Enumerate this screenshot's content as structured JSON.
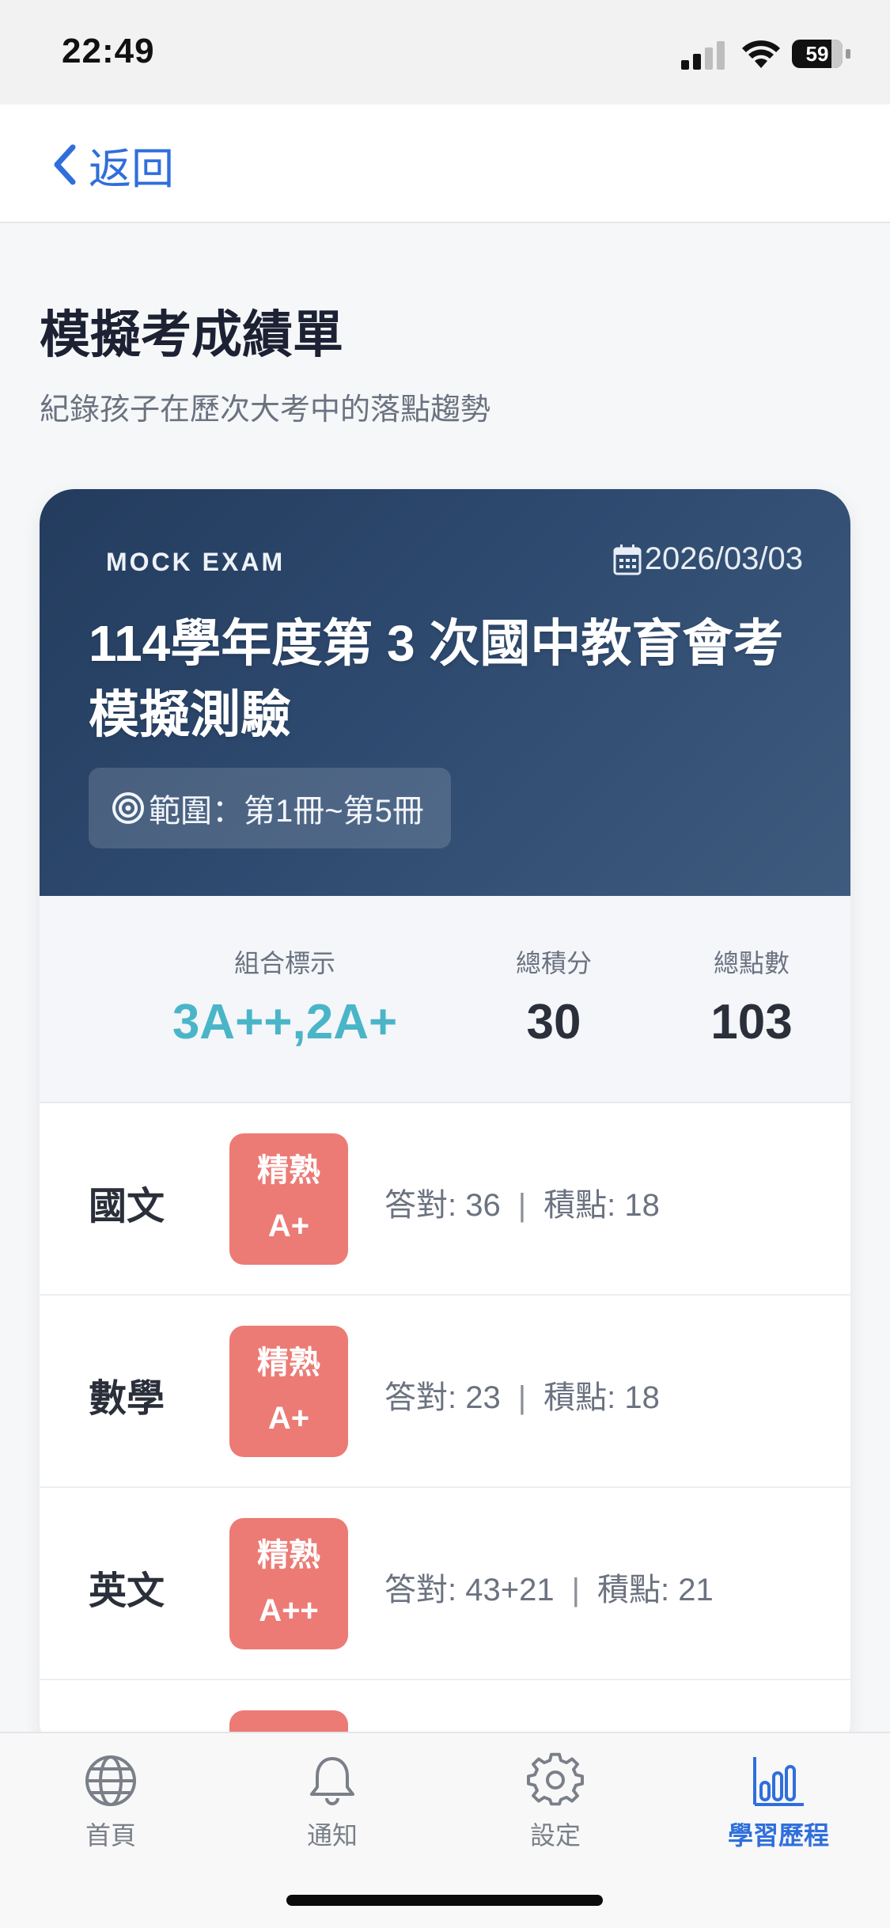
{
  "status_bar": {
    "time": "22:49",
    "battery": "59"
  },
  "nav": {
    "back_label": "返回"
  },
  "header": {
    "title": "模擬考成績單",
    "subtitle": "紀錄孩子在歷次大考中的落點趨勢"
  },
  "exam": {
    "tag": "MOCK EXAM",
    "date": "2026/03/03",
    "title": "114學年度第 3 次國中教育會考模擬測驗",
    "range": "範圍：第1冊~第5冊"
  },
  "summary": {
    "combo_label": "組合標示",
    "combo_value": "3A++,2A+",
    "total_label": "總積分",
    "total_value": "30",
    "points_label": "總點數",
    "points_value": "103"
  },
  "subjects": [
    {
      "name": "國文",
      "level": "精熟",
      "grade": "A+",
      "correct": "答對: 36",
      "points": "積點: 18"
    },
    {
      "name": "數學",
      "level": "精熟",
      "grade": "A+",
      "correct": "答對: 23",
      "points": "積點: 18"
    },
    {
      "name": "英文",
      "level": "精熟",
      "grade": "A++",
      "correct": "答對: 43+21",
      "points": "積點: 21"
    }
  ],
  "tabs": [
    {
      "label": "首頁",
      "icon": "globe-icon"
    },
    {
      "label": "通知",
      "icon": "bell-icon"
    },
    {
      "label": "設定",
      "icon": "gear-icon"
    },
    {
      "label": "學習歷程",
      "icon": "bar-chart-icon",
      "active": true
    }
  ],
  "colors": {
    "accent": "#2f6fdc",
    "combo": "#4bb5c8",
    "badge": "#ec7b75",
    "card_head": "#2f4b70"
  }
}
